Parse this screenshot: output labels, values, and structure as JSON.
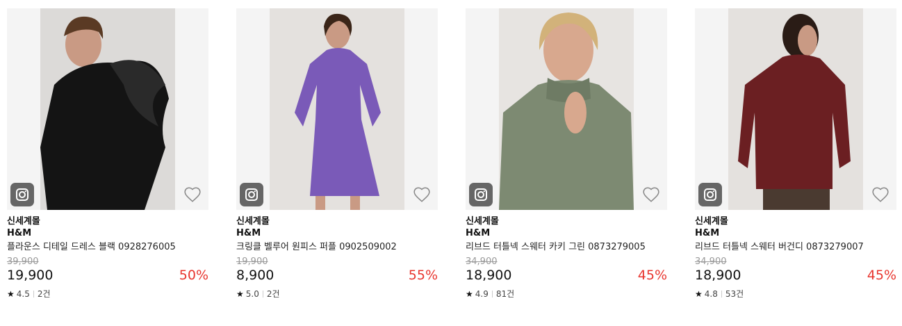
{
  "products": [
    {
      "store": "신세계몰",
      "brand": "H&M",
      "name": "플라운스 디테일 드레스 블랙 0928276005",
      "original_price": "39,900",
      "price": "19,900",
      "discount": "50%",
      "rating": "4.5",
      "reviews": "2건",
      "garment_color": "#1a1a1a"
    },
    {
      "store": "신세계몰",
      "brand": "H&M",
      "name": "크링클 벨루어 원피스 퍼플 0902509002",
      "original_price": "19,900",
      "price": "8,900",
      "discount": "55%",
      "rating": "5.0",
      "reviews": "2건",
      "garment_color": "#7a5ab8"
    },
    {
      "store": "신세계몰",
      "brand": "H&M",
      "name": "리브드 터틀넥 스웨터 카키 그린 0873279005",
      "original_price": "34,900",
      "price": "18,900",
      "discount": "45%",
      "rating": "4.9",
      "reviews": "81건",
      "garment_color": "#7d8a72"
    },
    {
      "store": "신세계몰",
      "brand": "H&M",
      "name": "리브드 터틀넥 스웨터 버건디 0873279007",
      "original_price": "34,900",
      "price": "18,900",
      "discount": "45%",
      "rating": "4.8",
      "reviews": "53건",
      "garment_color": "#6b1f22"
    }
  ],
  "colors": {
    "discount": "#e8352e",
    "background": "#f4f4f4",
    "instagram_badge": "#666666"
  },
  "icons": [
    "instagram-icon",
    "heart-icon",
    "star-icon"
  ]
}
